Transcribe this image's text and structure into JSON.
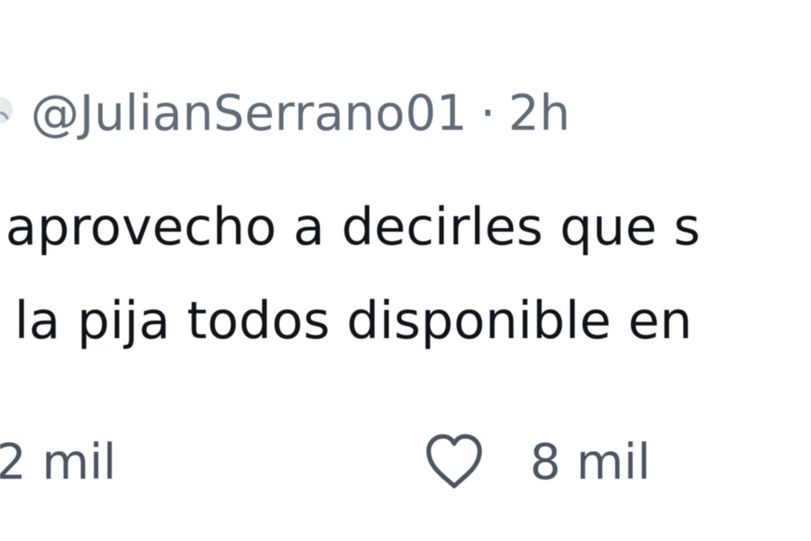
{
  "tweet": {
    "handle": "@JulianSerrano01",
    "separator": "·",
    "time": "2h",
    "text_lines": [
      "aprovecho a decirles que s",
      "la pija todos disponible en"
    ]
  },
  "actions": {
    "left_count": "2 mil",
    "like_count": "8 mil"
  },
  "icons": {
    "avatar": "avatar-icon",
    "like": "heart-icon"
  },
  "colors": {
    "text": "#0f1419",
    "meta": "#5f6b76",
    "icon": "#4a5560",
    "background": "#ffffff"
  }
}
